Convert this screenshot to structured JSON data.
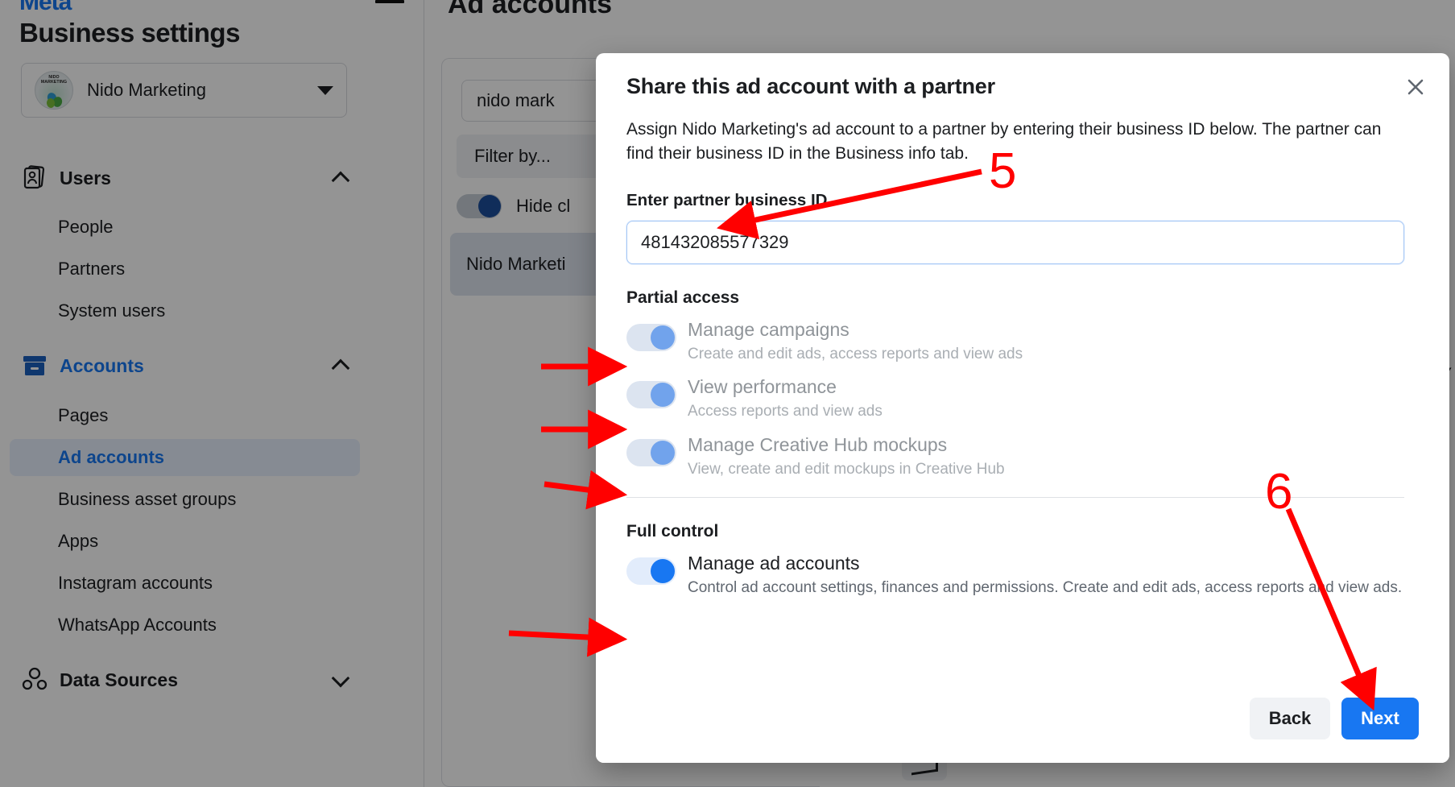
{
  "app": {
    "brand": "Meta",
    "minimize_icon": "window-minimize-icon"
  },
  "sidebar": {
    "title": "Business settings",
    "business": {
      "name": "Nido Marketing",
      "avatar_text_line1": "NIDO",
      "avatar_text_line2": "MARKETING",
      "dropdown_icon": "caret-down-icon"
    },
    "groups": [
      {
        "label": "Users",
        "icon": "id-card-icon",
        "expanded": true,
        "chevron": "chevron-up-icon",
        "items": [
          {
            "label": "People"
          },
          {
            "label": "Partners"
          },
          {
            "label": "System users"
          }
        ]
      },
      {
        "label": "Accounts",
        "icon": "archive-box-icon",
        "expanded": true,
        "chevron": "chevron-up-icon",
        "items": [
          {
            "label": "Pages"
          },
          {
            "label": "Ad accounts"
          },
          {
            "label": "Business asset groups"
          },
          {
            "label": "Apps"
          },
          {
            "label": "Instagram accounts"
          },
          {
            "label": "WhatsApp Accounts"
          }
        ]
      },
      {
        "label": "Data Sources",
        "icon": "people-icon",
        "expanded": false,
        "chevron": "chevron-down-icon",
        "items": []
      }
    ],
    "active_item": "Ad accounts"
  },
  "main": {
    "page_title": "Ad accounts",
    "search_value": "nido mark",
    "filter_label": "Filter by...",
    "hide_toggle_label": "Hide cl",
    "selected_account": "Nido Marketi",
    "right_edge_text": "Y"
  },
  "modal": {
    "title": "Share this ad account with a partner",
    "close_icon": "close-icon",
    "description": "Assign Nido Marketing's ad account to a partner by entering their business ID below. The partner can find their business ID in the Business info tab.",
    "field_label": "Enter partner business ID",
    "business_id_value": "481432085577329",
    "business_id_placeholder": "Enter partner business ID",
    "partial_access": {
      "heading": "Partial access",
      "permissions": [
        {
          "title": "Manage campaigns",
          "description": "Create and edit ads, access reports and view ads",
          "enabled": false,
          "toggle_on": true
        },
        {
          "title": "View performance",
          "description": "Access reports and view ads",
          "enabled": false,
          "toggle_on": true
        },
        {
          "title": "Manage Creative Hub mockups",
          "description": "View, create and edit mockups in Creative Hub",
          "enabled": false,
          "toggle_on": true
        }
      ]
    },
    "full_control": {
      "heading": "Full control",
      "permissions": [
        {
          "title": "Manage ad accounts",
          "description": "Control ad account settings, finances and permissions. Create and edit ads, access reports and view ads.",
          "enabled": true,
          "toggle_on": true
        }
      ]
    },
    "footer": {
      "back_label": "Back",
      "next_label": "Next"
    }
  },
  "annotations": {
    "numbers": [
      {
        "id": "5",
        "label": "5",
        "points_to": "business-id-input"
      },
      {
        "id": "6",
        "label": "6",
        "points_to": "next-button"
      }
    ],
    "color": "#ff0000",
    "arrows": [
      {
        "points_to": "toggle-manage-campaigns"
      },
      {
        "points_to": "toggle-view-performance"
      },
      {
        "points_to": "toggle-manage-creative-hub-mockups"
      },
      {
        "points_to": "toggle-manage-ad-accounts"
      },
      {
        "points_to": "business-id-input"
      },
      {
        "points_to": "next-button"
      }
    ]
  },
  "colors": {
    "accent": "#1877f2",
    "toggle_disabled": "#71a3ec",
    "toggle_active": "#1877f2",
    "annotation": "#ff0000",
    "active_nav_bg": "#e7f0fd"
  }
}
